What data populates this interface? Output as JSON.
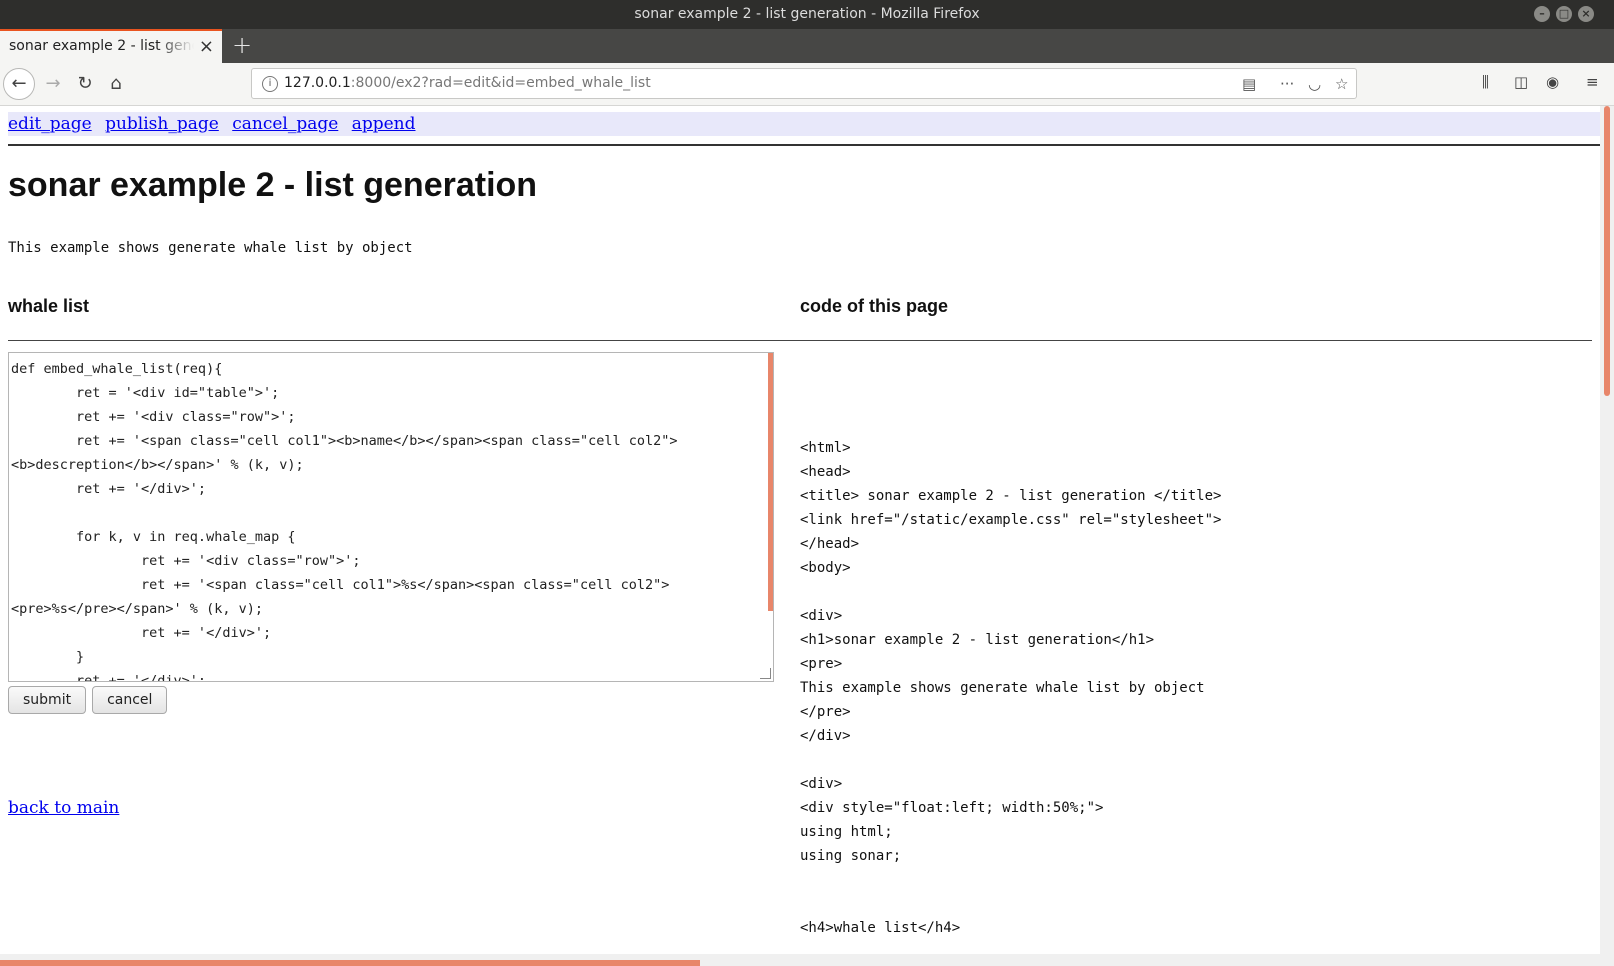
{
  "window": {
    "title": "sonar example 2 - list generation - Mozilla Firefox",
    "buttons": [
      "–",
      "□",
      "×"
    ]
  },
  "tab": {
    "label": "sonar example 2 - list generation",
    "close": "×",
    "new_tab": "+"
  },
  "nav": {
    "back": "←",
    "forward": "→",
    "reload": "↻",
    "home": "⌂",
    "url_host": "127.0.0.1",
    "url_rest": ":8000/ex2?rad=edit&id=embed_whale_list",
    "page_actions": "···",
    "reader_icon": "▤",
    "pocket_icon": "◡",
    "bookmark_icon": "☆",
    "library_icon": "⫼",
    "sidebar_icon": "◫",
    "account_icon": "◉",
    "menu_icon": "≡"
  },
  "menu": {
    "edit_page": "edit_page",
    "publish_page": "publish_page",
    "cancel_page": "cancel_page",
    "append": "append"
  },
  "page": {
    "title": "sonar example 2 - list generation",
    "description": "This example shows generate whale list by object"
  },
  "left": {
    "heading": "whale list",
    "editor_text": "def embed_whale_list(req){\n        ret = '<div id=\"table\">';\n        ret += '<div class=\"row\">';\n        ret += '<span class=\"cell col1\"><b>name</b></span><span class=\"cell col2\">\n<b>descreption</b></span>' % (k, v);\n        ret += '</div>';\n\n        for k, v in req.whale_map {\n                ret += '<div class=\"row\">';\n                ret += '<span class=\"cell col1\">%s</span><span class=\"cell col2\">\n<pre>%s</pre></span>' % (k, v);\n                ret += '</div>';\n        }\n        ret += '</div>';",
    "submit": "submit",
    "cancel": "cancel",
    "back_link": "back to main"
  },
  "right": {
    "heading": "code of this page",
    "code": "<html>\n<head>\n<title> sonar example 2 - list generation </title>\n<link href=\"/static/example.css\" rel=\"stylesheet\">\n</head>\n<body>\n\n<div>\n<h1>sonar example 2 - list generation</h1>\n<pre>\nThis example shows generate whale list by object\n</pre>\n</div>\n\n<div>\n<div style=\"float:left; width:50%;\">\nusing html;\nusing sonar;\n\n\n<h4>whale list</h4>"
  }
}
